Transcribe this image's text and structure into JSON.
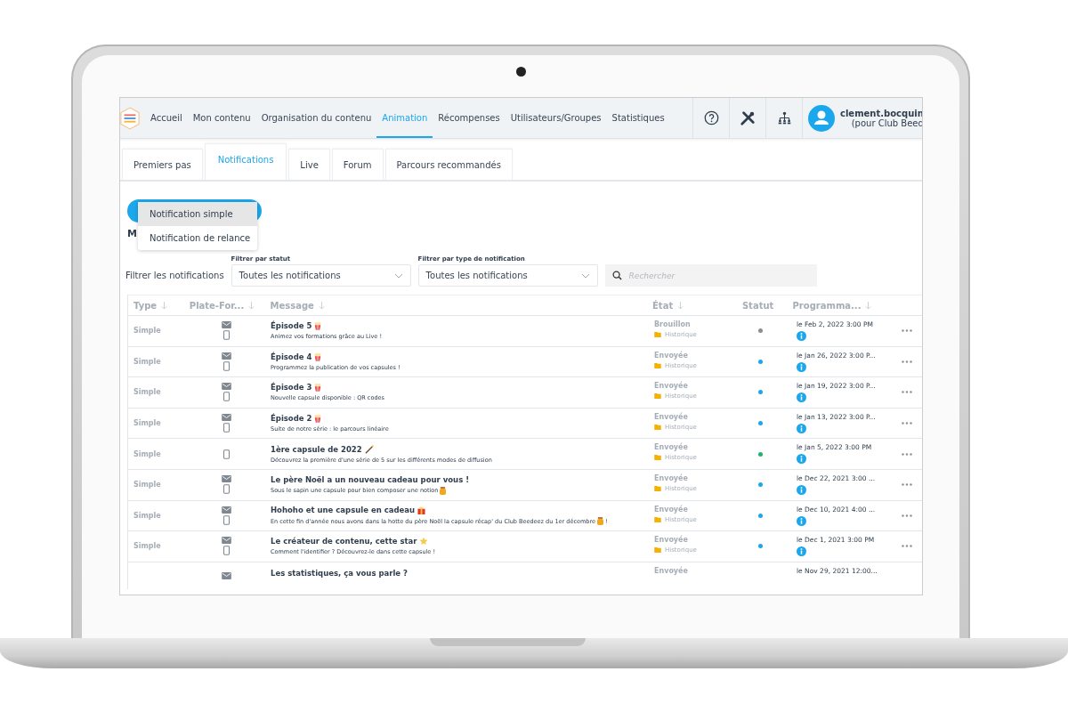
{
  "nav": [
    {
      "label": "Accueil",
      "selected": false
    },
    {
      "label": "Mon contenu",
      "selected": false
    },
    {
      "label": "Organisation du contenu",
      "selected": false
    },
    {
      "label": "Animation",
      "selected": true
    },
    {
      "label": "Récompenses",
      "selected": false
    },
    {
      "label": "Utilisateurs/Groupes",
      "selected": false
    },
    {
      "label": "Statistiques",
      "selected": false
    }
  ],
  "user": {
    "name": "clement.bocquin",
    "org": "(pour Club Beed"
  },
  "tabs": [
    {
      "label": "Premiers pas",
      "selected": false
    },
    {
      "label": "Notifications",
      "selected": true
    },
    {
      "label": "Live",
      "selected": false
    },
    {
      "label": "Forum",
      "selected": false
    },
    {
      "label": "Parcours recommandés",
      "selected": false
    }
  ],
  "menu": [
    {
      "label": "Notification simple",
      "selected": true
    },
    {
      "label": "Notification de relance",
      "selected": false
    }
  ],
  "heading": "M",
  "filters": {
    "label": "Filtrer les notifications",
    "status": {
      "caption": "Filtrer par statut",
      "value": "Toutes les notifications"
    },
    "type": {
      "caption": "Filtrer par type de notification",
      "value": "Toutes les notifications"
    },
    "search": {
      "placeholder": "Rechercher"
    }
  },
  "columns": [
    {
      "label": "Type",
      "sortable": true
    },
    {
      "label": "Plate-For...",
      "sortable": true
    },
    {
      "label": "Message",
      "sortable": true
    },
    {
      "label": "État",
      "sortable": true
    },
    {
      "label": "Statut",
      "sortable": false
    },
    {
      "label": "Programma...",
      "sortable": true
    }
  ],
  "rows": [
    {
      "type": "Simple",
      "email": true,
      "mobile": true,
      "title": "Épisode 5",
      "title_icon": {
        "kind": "popcorn"
      },
      "desc": "Animez vos formations grâce au Live !",
      "state": "Brouillon",
      "folder": "Historique",
      "color": "#8a8f96",
      "date": "le Feb 2, 2022 3:00 PM"
    },
    {
      "type": "Simple",
      "email": true,
      "mobile": true,
      "title": "Épisode 4",
      "title_icon": {
        "kind": "popcorn"
      },
      "desc": "Programmez la publication de vos capsules !",
      "state": "Envoyée",
      "folder": "Historique",
      "color": "#1aa7ec",
      "date": "le Jan 26, 2022 3:00 P..."
    },
    {
      "type": "Simple",
      "email": true,
      "mobile": true,
      "title": "Épisode 3",
      "title_icon": {
        "kind": "popcorn"
      },
      "desc": "Nouvelle capsule disponible : QR codes",
      "state": "Envoyée",
      "folder": "Historique",
      "color": "#1aa7ec",
      "date": "le Jan 19, 2022 3:00 P..."
    },
    {
      "type": "Simple",
      "email": true,
      "mobile": true,
      "title": "Épisode 2",
      "title_icon": {
        "kind": "popcorn"
      },
      "desc": "Suite de notre série : le parcours linéaire",
      "state": "Envoyée",
      "folder": "Historique",
      "color": "#1aa7ec",
      "date": "le Jan 13, 2022 3:00 P..."
    },
    {
      "type": "Simple",
      "email": false,
      "mobile": true,
      "title": "1ère capsule de 2022",
      "title_icon": {
        "kind": "wand"
      },
      "desc": "Découvrez la première d'une série de 5 sur les différents modes de diffusion",
      "state": "Envoyée",
      "folder": "Historique",
      "color": "#1db36b",
      "date": "le Jan 5, 2022 3:00 PM"
    },
    {
      "type": "Simple",
      "email": true,
      "mobile": true,
      "title": "Le père Noël a un nouveau cadeau pour vous !",
      "desc": "Sous le sapin une capsule pour bien composer une notion",
      "desc_icon": {
        "kind": "honey"
      },
      "state": "Envoyée",
      "folder": "Historique",
      "color": "#1aa7ec",
      "date": "le Dec 22, 2021 3:00 ..."
    },
    {
      "type": "Simple",
      "email": true,
      "mobile": true,
      "title": "Hohoho et une capsule en cadeau",
      "title_icon": {
        "kind": "gift"
      },
      "desc": "En cette fin d'année nous avons dans la hotte du père Noël la capsule récap' du Club Beedeez du 1er décembre",
      "desc_icon": {
        "kind": "honey"
      },
      "desc_end": "!",
      "state": "Envoyée",
      "folder": "Historique",
      "color": "#1aa7ec",
      "date": "le Dec 10, 2021 4:00 ..."
    },
    {
      "type": "Simple",
      "email": true,
      "mobile": true,
      "title": "Le créateur de contenu, cette star",
      "title_icon": {
        "kind": "star"
      },
      "desc": "Comment l'identifier ? Découvrez-le dans cette capsule !",
      "state": "Envoyée",
      "folder": "Historique",
      "color": "#1aa7ec",
      "date": "le Dec 1, 2021 3:00 PM"
    },
    {
      "email": true,
      "mobile": false,
      "title": "Les statistiques, ça vous parle ?",
      "state": "Envoyée",
      "date": "le Nov 29, 2021 12:00..."
    }
  ]
}
